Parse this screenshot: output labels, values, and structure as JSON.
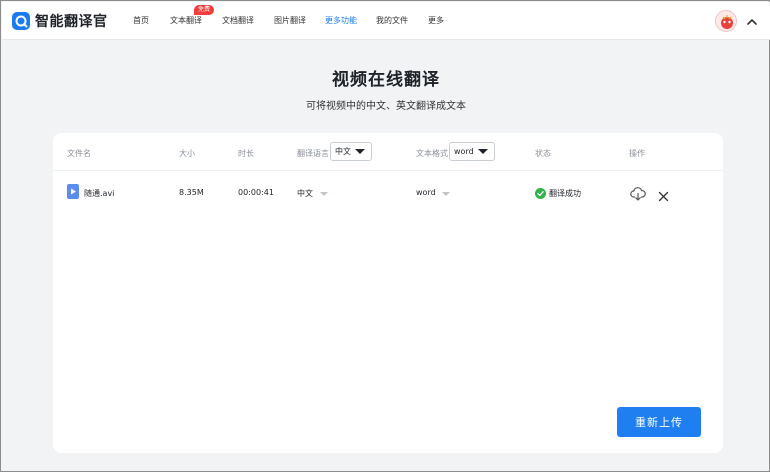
{
  "app": {
    "title": "智能翻译官"
  },
  "nav": {
    "items": [
      {
        "label": "首页"
      },
      {
        "label": "文本翻译",
        "badge": "免费"
      },
      {
        "label": "文档翻译"
      },
      {
        "label": "图片翻译"
      },
      {
        "label": "更多功能",
        "active": true
      },
      {
        "label": "我的文件"
      },
      {
        "label": "更多"
      }
    ]
  },
  "page": {
    "title": "视频在线翻译",
    "subtitle": "可将视频中的中文、英文翻译成文本"
  },
  "table": {
    "headers": {
      "filename": "文件名",
      "size": "大小",
      "duration": "时长",
      "language": "翻译语言",
      "format": "文本格式",
      "status": "状态",
      "actions": "操作"
    },
    "language_select": "中文",
    "format_select": "word",
    "rows": [
      {
        "filename": "随通.avi",
        "size": "8.35M",
        "duration": "00:00:41",
        "language": "中文",
        "format": "word",
        "status": "翻译成功"
      }
    ]
  },
  "buttons": {
    "reupload": "重新上传"
  },
  "colors": {
    "accent": "#1f7ff0",
    "success": "#2fb34a",
    "badge": "#f23c3c"
  }
}
